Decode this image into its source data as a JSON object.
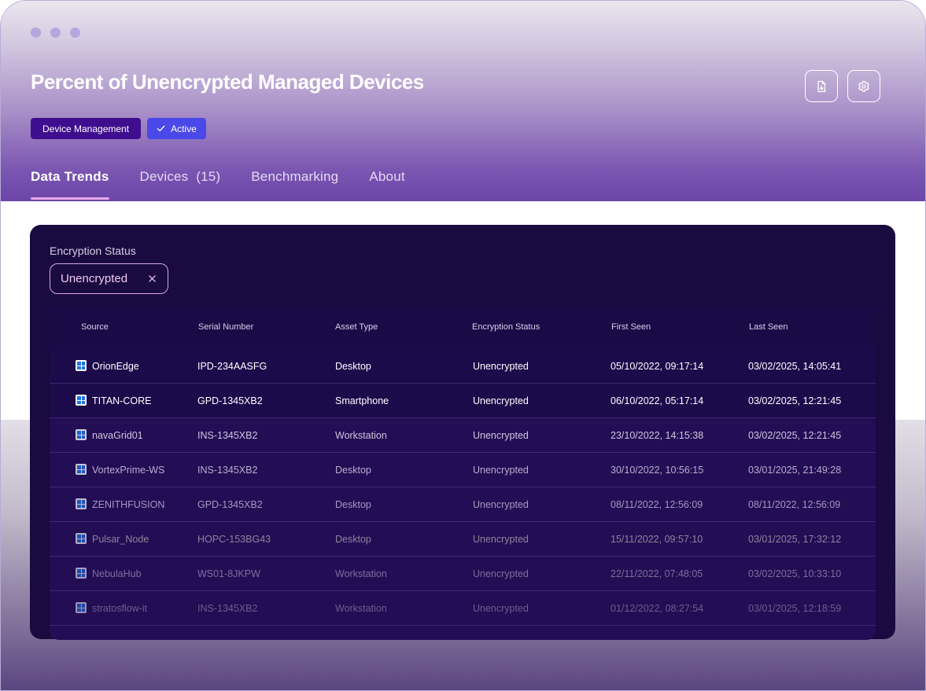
{
  "window": {
    "title": "Percent of Unencrypted Managed Devices",
    "tags": [
      {
        "label": "Device Management"
      },
      {
        "label": "Active",
        "icon": "check-icon"
      }
    ],
    "actions": [
      {
        "name": "export-report-button",
        "icon": "file-download-icon"
      },
      {
        "name": "settings-button",
        "icon": "gear-icon"
      }
    ]
  },
  "tabs": [
    {
      "label": "Data Trends",
      "active": true
    },
    {
      "label": "Devices  (15)",
      "active": false
    },
    {
      "label": "Benchmarking",
      "active": false
    },
    {
      "label": "About",
      "active": false
    }
  ],
  "filter": {
    "label": "Encryption Status",
    "chip": "Unencrypted"
  },
  "table": {
    "columns": [
      "Source",
      "Serial Number",
      "Asset Type",
      "Encryption Status",
      "First Seen",
      "Last Seen"
    ],
    "rows": [
      {
        "source": "OrionEdge",
        "serial": "IPD-234AASFG",
        "type": "Desktop",
        "status": "Unencrypted",
        "first": "05/10/2022, 09:17:14",
        "last": "03/02/2025, 14:05:41"
      },
      {
        "source": "TITAN-CORE",
        "serial": "GPD-1345XB2",
        "type": "Smartphone",
        "status": "Unencrypted",
        "first": "06/10/2022, 05:17:14",
        "last": "03/02/2025, 12:21:45"
      },
      {
        "source": "navaGrid01",
        "serial": "INS-1345XB2",
        "type": "Workstation",
        "status": "Unencrypted",
        "first": "23/10/2022, 14:15:38",
        "last": "03/02/2025, 12:21:45"
      },
      {
        "source": "VortexPrime-WS",
        "serial": "INS-1345XB2",
        "type": "Desktop",
        "status": "Unencrypted",
        "first": "30/10/2022, 10:56:15",
        "last": "03/01/2025, 21:49:28"
      },
      {
        "source": "ZENITHFUSION",
        "serial": "GPD-1345XB2",
        "type": "Desktop",
        "status": "Unencrypted",
        "first": "08/11/2022, 12:56:09",
        "last": "08/11/2022, 12:56:09"
      },
      {
        "source": "Pulsar_Node",
        "serial": "HOPC-153BG43",
        "type": "Desktop",
        "status": "Unencrypted",
        "first": "15/11/2022, 09:57:10",
        "last": "03/01/2025, 17:32:12"
      },
      {
        "source": "NebulaHub",
        "serial": "WS01-8JKPW",
        "type": "Workstation",
        "status": "Unencrypted",
        "first": "22/11/2022, 07:48:05",
        "last": "03/02/2025, 10:33:10"
      },
      {
        "source": "stratosflow-it",
        "serial": "INS-1345XB2",
        "type": "Workstation",
        "status": "Unencrypted",
        "first": "01/12/2022, 08:27:54",
        "last": "03/01/2025, 12:18:59"
      }
    ]
  },
  "colors": {
    "panel": "#190a3f",
    "tag_device_management": "#3f0e8f",
    "tag_active": "#4a48e8",
    "tab_underline": "#e8a8e8",
    "chip_border": "#d9a6e6",
    "windows_icon": "#1e74e6"
  }
}
